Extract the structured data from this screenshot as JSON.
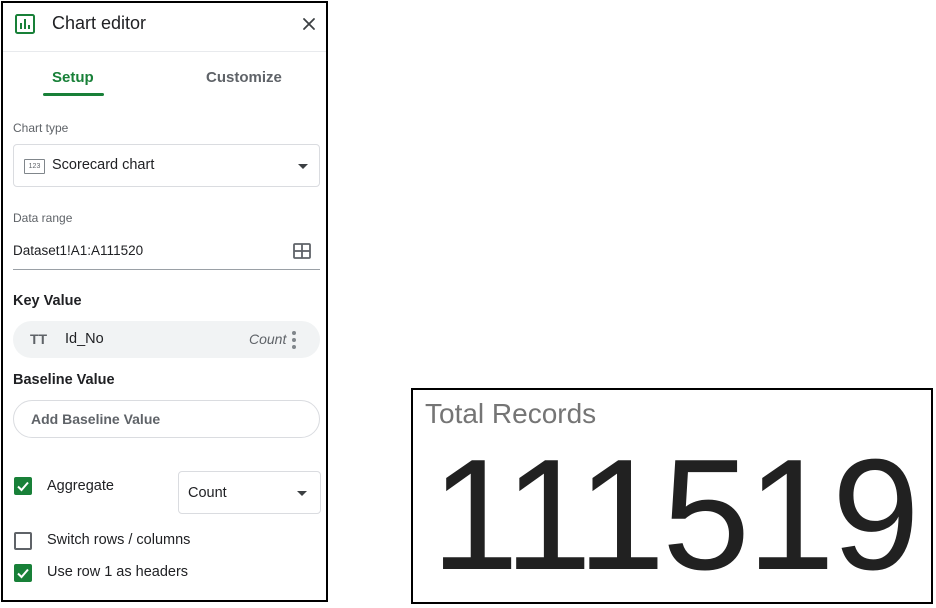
{
  "editor": {
    "title": "Chart editor",
    "tabs": {
      "setup": "Setup",
      "customize": "Customize"
    },
    "chart_type": {
      "label": "Chart type",
      "value": "Scorecard chart",
      "icon_text": "123"
    },
    "data_range": {
      "label": "Data range",
      "value": "Dataset1!A1:A111520"
    },
    "key_value": {
      "heading": "Key Value",
      "field_icon": "TT",
      "field": "Id_No",
      "aggregation": "Count"
    },
    "baseline": {
      "heading": "Baseline Value",
      "button": "Add Baseline Value"
    },
    "options": {
      "aggregate": {
        "label": "Aggregate",
        "checked": true,
        "select_value": "Count"
      },
      "switch_rows": {
        "label": "Switch rows / columns",
        "checked": false
      },
      "use_headers": {
        "label": "Use row 1 as headers",
        "checked": true
      }
    }
  },
  "scorecard": {
    "title": "Total Records",
    "value": "111519"
  },
  "colors": {
    "accent": "#188038",
    "text": "#202124",
    "muted": "#5f6368"
  }
}
